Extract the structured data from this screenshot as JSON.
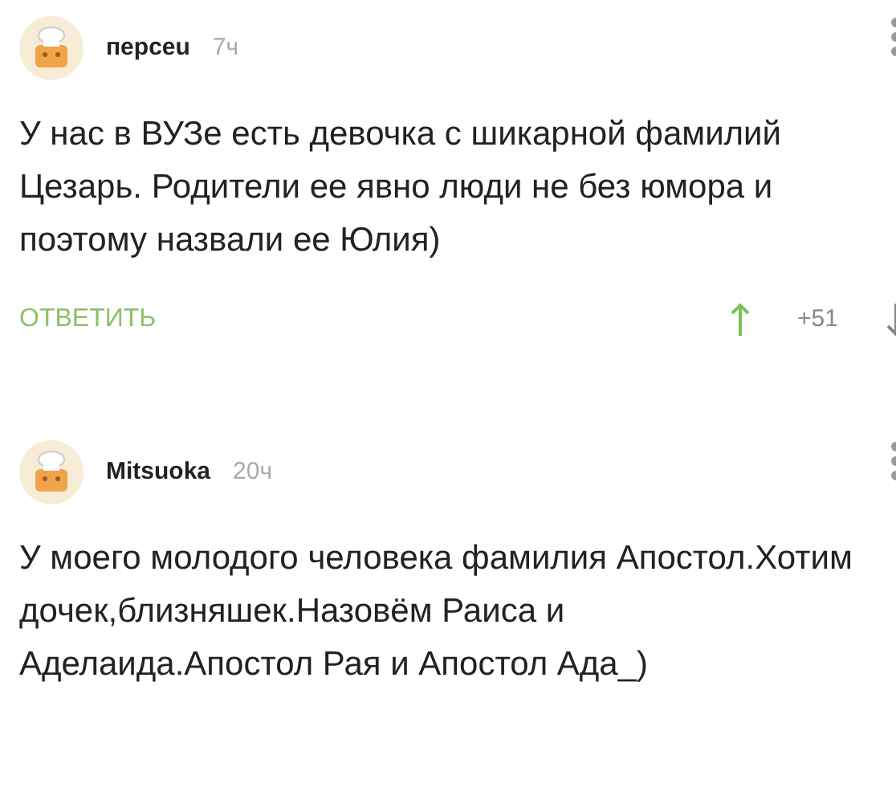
{
  "comments": [
    {
      "author": "пepceu",
      "time": "7ч",
      "text": "У нас в ВУЗе есть девочка с шикарной фамилий Цезарь. Родители ее явно люди не без юмора и поэтому назвали ее Юлия)",
      "reply": "ОТВЕТИТЬ",
      "rating": "+51",
      "upvoted": true
    },
    {
      "author": "Mitsuoka",
      "time": "20ч",
      "text": "У моего молодого человека фамилия Апостол.Хотим дочек,близняшек.Назовём Раиса и Аделаида.Апостол Рая и Апостол Ада_)"
    }
  ]
}
